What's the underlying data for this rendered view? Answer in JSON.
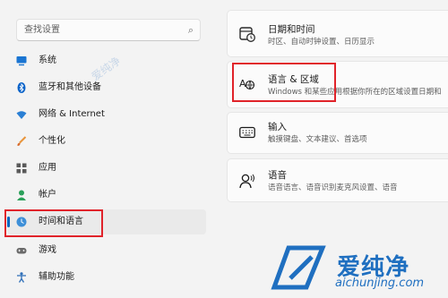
{
  "search": {
    "placeholder": "查找设置",
    "icon": "search-icon"
  },
  "sidebar": {
    "items": [
      {
        "label": "系统",
        "icon": "monitor-icon"
      },
      {
        "label": "蓝牙和其他设备",
        "icon": "bluetooth-icon"
      },
      {
        "label": "网络 & Internet",
        "icon": "wifi-icon"
      },
      {
        "label": "个性化",
        "icon": "brush-icon"
      },
      {
        "label": "应用",
        "icon": "apps-icon"
      },
      {
        "label": "帐户",
        "icon": "person-icon"
      },
      {
        "label": "时间和语言",
        "icon": "globe-clock-icon",
        "selected": true
      },
      {
        "label": "游戏",
        "icon": "gamepad-icon"
      },
      {
        "label": "辅助功能",
        "icon": "accessibility-icon"
      }
    ]
  },
  "cards": [
    {
      "title": "日期和时间",
      "subtitle": "时区、自动时钟设置、日历显示",
      "icon": "calendar-clock-icon"
    },
    {
      "title": "语言 & 区域",
      "subtitle": "Windows 和某些应用根据你所在的区域设置日期和",
      "icon": "language-icon"
    },
    {
      "title": "输入",
      "subtitle": "触摸键盘、文本建议、首选项",
      "icon": "keyboard-icon"
    },
    {
      "title": "语音",
      "subtitle": "语音语言、语音识别麦克风设置、语音",
      "icon": "speech-icon"
    }
  ],
  "watermark": {
    "brand": "爱纯净",
    "url": "aichunjing.com"
  },
  "colors": {
    "accent": "#0067c0",
    "highlight": "#e0232a",
    "background": "#f3f3f3",
    "card": "#fbfbfb"
  }
}
